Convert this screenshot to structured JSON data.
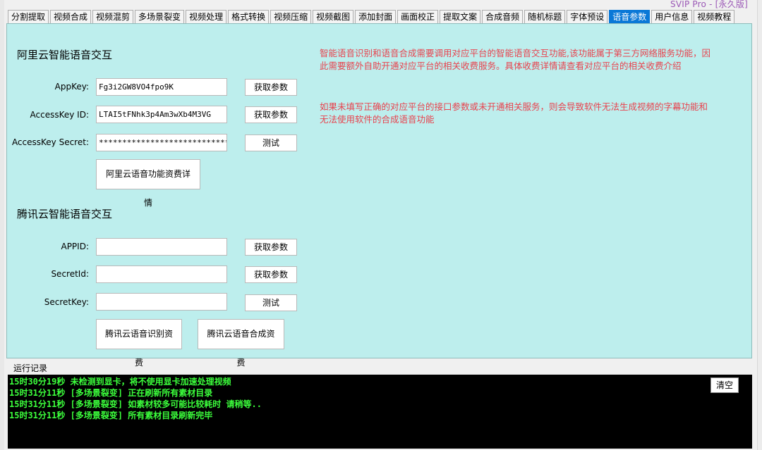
{
  "header": {
    "edition": "SVIP Pro - [永久版]"
  },
  "tabs": [
    "分割提取",
    "视频合成",
    "视频混剪",
    "多场景裂变",
    "视频处理",
    "格式转换",
    "视频压缩",
    "视频截图",
    "添加封面",
    "画面校正",
    "提取文案",
    "合成音频",
    "随机标题",
    "字体预设",
    "语音参数",
    "用户信息",
    "视频教程"
  ],
  "active_tab": "语音参数",
  "aliyun": {
    "title": "阿里云智能语音交互",
    "appkey_label": "AppKey:",
    "appkey_value": "Fg3i2GW8VO4fpo9K",
    "accesskey_id_label": "AccessKey ID:",
    "accesskey_id_value": "LTAI5tFNhk3p4Am3wXb4M3VG",
    "accesskey_secret_label": "AccessKey Secret:",
    "accesskey_secret_value": "******************************",
    "get_params_label": "获取参数",
    "test_label": "测试",
    "pricing_label": "阿里云语音功能资费详情"
  },
  "tencent": {
    "title": "腾讯云智能语音交互",
    "appid_label": "APPID:",
    "appid_value": "",
    "secretid_label": "SecretId:",
    "secretid_value": "",
    "secretkey_label": "SecretKey:",
    "secretkey_value": "",
    "get_params_label": "获取参数",
    "test_label": "测试",
    "asr_pricing_label": "腾讯云语音识别资费",
    "tts_pricing_label": "腾讯云语音合成资费"
  },
  "info": {
    "paragraph1": "智能语音识别和语音合成需要调用对应平台的智能语音交互功能,该功能属于第三方网络服务功能，因此需要额外自助开通对应平台的相关收费服务。具体收费详情请查看对应平台的相关收费介绍",
    "paragraph2": "如果未填写正确的对应平台的接口参数或未开通相关服务，则会导致软件无法生成视频的字幕功能和无法使用软件的合成语音功能"
  },
  "log": {
    "title": "运行记录",
    "clear_label": "清空",
    "lines": [
      "15时30分19秒 未检测到显卡，将不使用显卡加速处理视频",
      "15时31分11秒 [多场景裂变] 正在刷新所有素材目录",
      "15时31分11秒 [多场景裂变] 如素材较多可能比较耗时 请稍等..",
      "15时31分11秒 [多场景裂变] 所有素材目录刷新完毕"
    ]
  }
}
